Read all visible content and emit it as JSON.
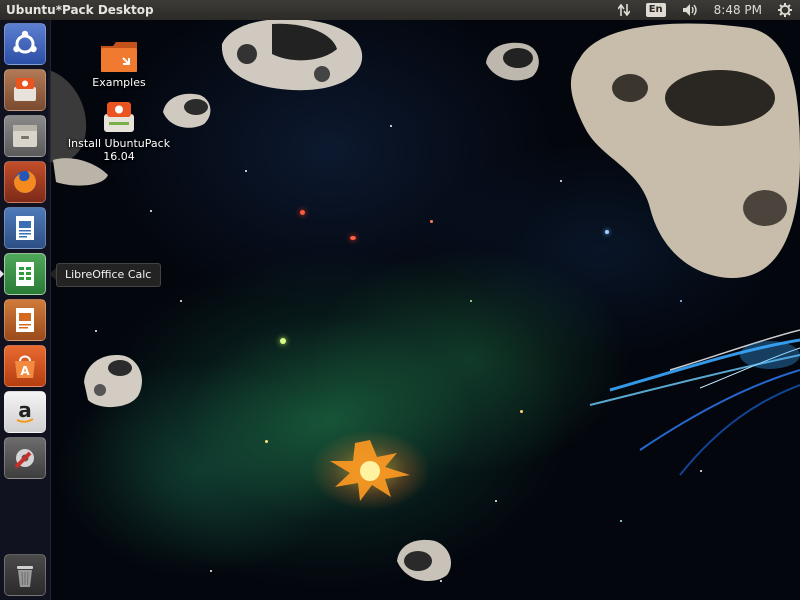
{
  "top_panel": {
    "title": "Ubuntu*Pack Desktop",
    "keyboard_layout": "En",
    "clock": "8:48 PM"
  },
  "launcher": {
    "items": [
      {
        "name": "dash-home",
        "icon": "ubuntu-logo-icon"
      },
      {
        "name": "install-ubuntupack",
        "icon": "installer-icon"
      },
      {
        "name": "files",
        "icon": "file-manager-icon"
      },
      {
        "name": "firefox",
        "icon": "firefox-icon"
      },
      {
        "name": "libreoffice-writer",
        "icon": "writer-icon"
      },
      {
        "name": "libreoffice-calc",
        "icon": "calc-icon"
      },
      {
        "name": "libreoffice-impress",
        "icon": "impress-icon"
      },
      {
        "name": "ubuntu-software",
        "icon": "software-center-icon"
      },
      {
        "name": "amazon",
        "icon": "amazon-icon"
      },
      {
        "name": "system-settings",
        "icon": "settings-icon"
      }
    ],
    "trash": {
      "icon": "trash-icon"
    },
    "tooltip": "LibreOffice Calc"
  },
  "desktop": {
    "icons": [
      {
        "label": "Examples",
        "icon": "folder-icon"
      },
      {
        "label_line1": "Install UbuntuPack",
        "label_line2": "16.04",
        "icon": "installer-icon"
      }
    ]
  },
  "colors": {
    "panel": "#3c3b37",
    "launcher": "#121622",
    "ubuntu_orange": "#e95420",
    "calc_green": "#2f9b3a"
  }
}
